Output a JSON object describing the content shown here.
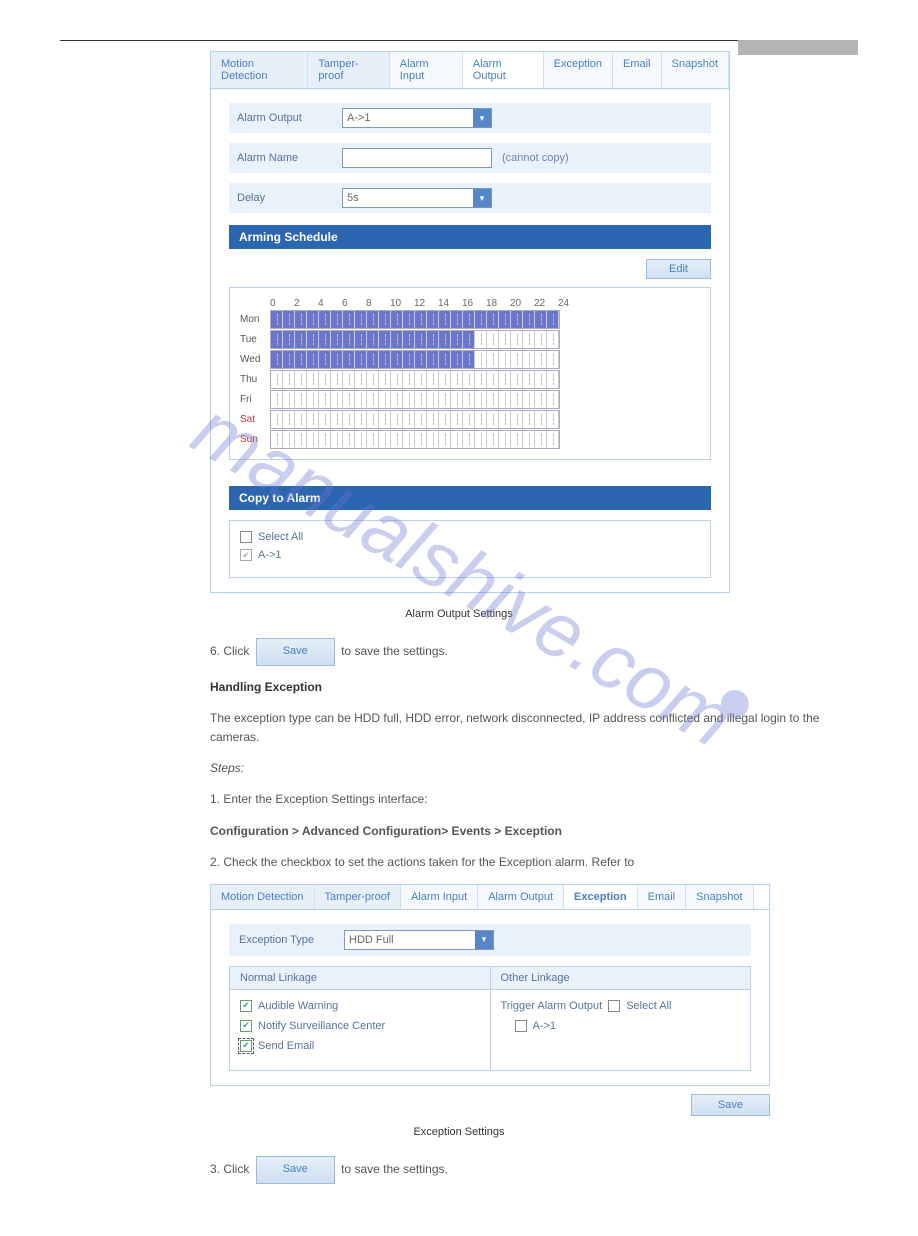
{
  "header_tag": "",
  "screenshot1": {
    "tabs": [
      "Motion Detection",
      "Tamper-proof",
      "Alarm Input",
      "Alarm Output",
      "Exception",
      "Email",
      "Snapshot"
    ],
    "active_tab_index": 3,
    "fields": {
      "alarm_output_label": "Alarm Output",
      "alarm_output_value": "A->1",
      "alarm_name_label": "Alarm Name",
      "alarm_name_value": "",
      "alarm_name_note": "(cannot copy)",
      "delay_label": "Delay",
      "delay_value": "5s"
    },
    "arming_title": "Arming Schedule",
    "edit_label": "Edit",
    "hours": [
      "0",
      "2",
      "4",
      "6",
      "8",
      "10",
      "12",
      "14",
      "16",
      "18",
      "20",
      "22",
      "24"
    ],
    "days": [
      {
        "name": "Mon",
        "wknd": false,
        "fill": 24
      },
      {
        "name": "Tue",
        "wknd": false,
        "fill": 17
      },
      {
        "name": "Wed",
        "wknd": false,
        "fill": 17
      },
      {
        "name": "Thu",
        "wknd": false,
        "fill": 0
      },
      {
        "name": "Fri",
        "wknd": false,
        "fill": 0
      },
      {
        "name": "Sat",
        "wknd": true,
        "fill": 0
      },
      {
        "name": "Sun",
        "wknd": true,
        "fill": 0
      }
    ],
    "copy_title": "Copy to Alarm",
    "select_all_label": "Select All",
    "copy_option_label": "A->1"
  },
  "caption1": "Alarm Output Settings",
  "step6": "6. Click                             to save the settings.",
  "sec_heading": "Handling Exception",
  "sec_intro": "The exception type can be HDD full, HDD error, network disconnected, IP address conflicted and illegal login to the cameras.",
  "sec_steps_title": "Steps:",
  "sec_step1": "Enter the Exception Settings interface:",
  "sec_step1_path": "Configuration > Advanced Configuration> Events > Exception",
  "sec_step2_a": "Check the checkbox to set the actions taken for the Exception alarm. Refer to ",
  "sec_step2_b": "",
  "sec_step2_c": ".",
  "screenshot2": {
    "tabs": [
      "Motion Detection",
      "Tamper-proof",
      "Alarm Input",
      "Alarm Output",
      "Exception",
      "Email",
      "Snapshot"
    ],
    "active_tab_index": 4,
    "exception_type_label": "Exception Type",
    "exception_type_value": "HDD Full",
    "normal_linkage": "Normal Linkage",
    "other_linkage": "Other Linkage",
    "normal_items": [
      "Audible Warning",
      "Notify Surveillance Center",
      "Send Email"
    ],
    "trigger_label": "Trigger Alarm Output",
    "select_all_label": "Select All",
    "trigger_option": "A->1",
    "save_label": "Save"
  },
  "caption2": "Exception Settings",
  "step3": "3. Click                             to save the settings.",
  "inline_save": "Save"
}
